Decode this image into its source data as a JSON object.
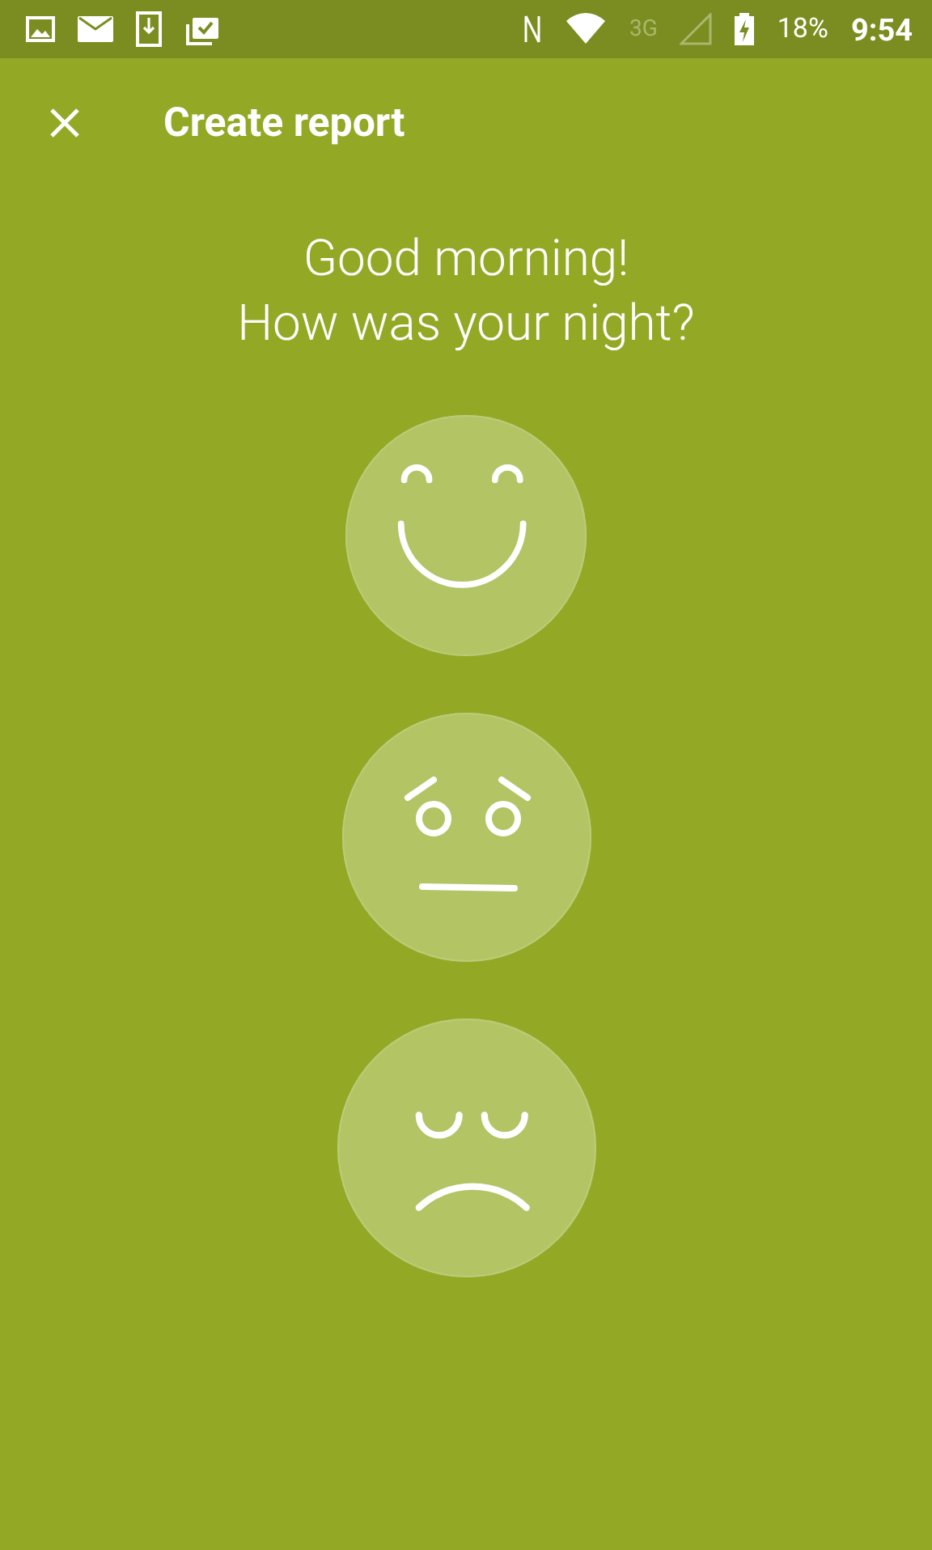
{
  "status_bar": {
    "network": "3G",
    "battery": "18%",
    "time": "9:54"
  },
  "toolbar": {
    "title": "Create report"
  },
  "greeting": [
    "Good morning!",
    "How was your night?"
  ],
  "moods": [
    {
      "kind": "happy"
    },
    {
      "kind": "neutral"
    },
    {
      "kind": "sad"
    }
  ]
}
